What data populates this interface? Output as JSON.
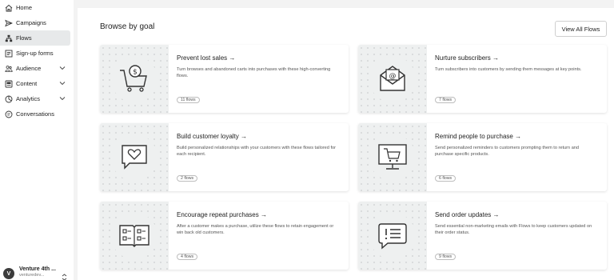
{
  "sidebar": {
    "items": [
      {
        "label": "Home",
        "icon": "home-icon",
        "expandable": false,
        "active": false
      },
      {
        "label": "Campaigns",
        "icon": "send-icon",
        "expandable": false,
        "active": false
      },
      {
        "label": "Flows",
        "icon": "flows-icon",
        "expandable": false,
        "active": true
      },
      {
        "label": "Sign-up forms",
        "icon": "form-icon",
        "expandable": false,
        "active": false
      },
      {
        "label": "Audience",
        "icon": "audience-icon",
        "expandable": true,
        "active": false
      },
      {
        "label": "Content",
        "icon": "content-icon",
        "expandable": true,
        "active": false
      },
      {
        "label": "Analytics",
        "icon": "analytics-icon",
        "expandable": true,
        "active": false
      },
      {
        "label": "Conversations",
        "icon": "conversations-icon",
        "expandable": false,
        "active": false
      }
    ],
    "account": {
      "initial": "V",
      "name": "Venture 4th ...",
      "sub": "venturedev..."
    }
  },
  "main": {
    "title": "Browse by goal",
    "view_all_label": "View All Flows",
    "cards": [
      {
        "title": "Prevent lost sales",
        "arrow": "→",
        "desc": "Turn browses and abandoned carts into purchases with these high-converting flows.",
        "badge": "11 flows",
        "icon": "shopping-cart-icon"
      },
      {
        "title": "Nurture subscribers",
        "arrow": "→",
        "desc": "Turn subscribers into customers by sending them messages at key points.",
        "badge": "7 flows",
        "icon": "email-envelope-icon"
      },
      {
        "title": "Build customer loyalty",
        "arrow": "→",
        "desc": "Build personalized relationships with your customers with these flows tailored for each recipient.",
        "badge": "2 flows",
        "icon": "heart-message-icon"
      },
      {
        "title": "Remind people to purchase",
        "arrow": "→",
        "desc": "Send personalized reminders to customers prompting them to return and purchase specific products.",
        "badge": "6 flows",
        "icon": "monitor-cart-icon"
      },
      {
        "title": "Encourage repeat purchases",
        "arrow": "→",
        "desc": "After a customer makes a purchase, utilize these flows to retain engagement or win back old customers.",
        "badge": "4 flows",
        "icon": "open-book-icon"
      },
      {
        "title": "Send order updates",
        "arrow": "→",
        "desc": "Send essential non-marketing emails with Flows to keep customers updated on their order status.",
        "badge": "9 flows",
        "icon": "alert-message-icon"
      }
    ]
  }
}
